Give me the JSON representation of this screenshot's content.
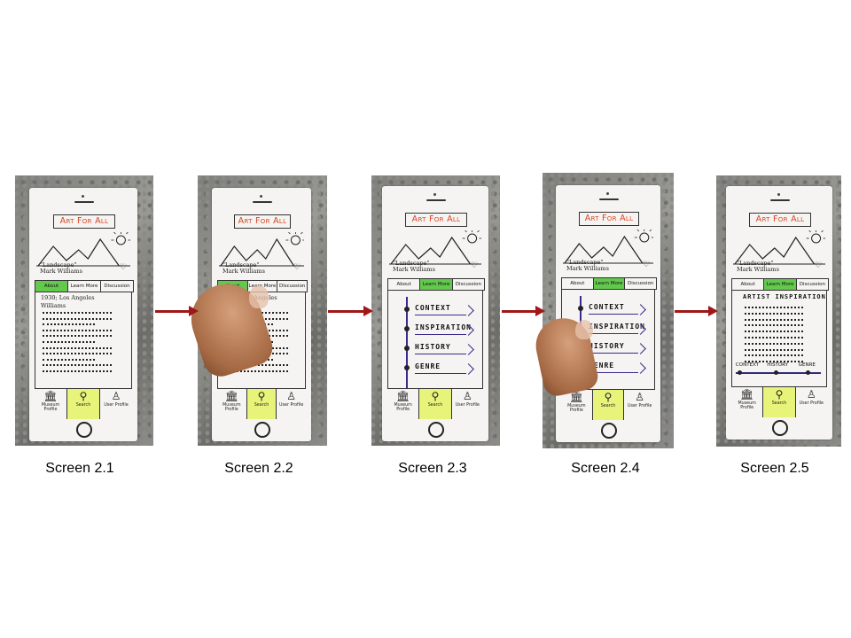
{
  "app": {
    "title": "Art For All",
    "artwork_title": "\"Landscape\"",
    "artist": "Mark Williams",
    "tabs": [
      "About",
      "Learn More",
      "Discussion"
    ],
    "nav": [
      {
        "label": "Museum\nProfile",
        "icon": "museum-icon"
      },
      {
        "label": "Search",
        "icon": "search-icon"
      },
      {
        "label": "User Profile",
        "icon": "user-icon"
      }
    ],
    "about_meta": "1930; Los Angeles",
    "about_meta2": "Williams",
    "learn_more_items": [
      "Context",
      "Inspiration",
      "History",
      "Genre"
    ],
    "artist_inspiration_heading": "Artist Inspiration",
    "timeline_labels": [
      "Context",
      "History",
      "Genre"
    ]
  },
  "screens": [
    {
      "caption": "Screen 2.1",
      "active_tab": 0
    },
    {
      "caption": "Screen 2.2",
      "active_tab": 0
    },
    {
      "caption": "Screen 2.3",
      "active_tab": 1
    },
    {
      "caption": "Screen 2.4",
      "active_tab": 1
    },
    {
      "caption": "Screen 2.5",
      "active_tab": 1
    }
  ],
  "colors": {
    "title_red": "#d9431e",
    "active_tab_green": "#62c94d",
    "active_nav_yellow": "#e8f37a",
    "arrow_red": "#a01717",
    "timeline_purple": "#3b2a8c"
  }
}
